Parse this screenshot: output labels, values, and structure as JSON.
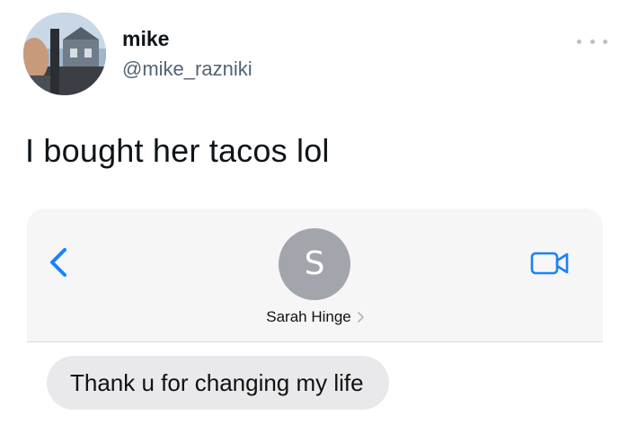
{
  "tweet": {
    "author_name": "mike",
    "author_handle": "@mike_razniki",
    "text": "I bought her tacos lol",
    "more_icon": "more-dots-icon"
  },
  "imessage": {
    "contact_initial": "S",
    "contact_name": "Sarah Hinge",
    "back_icon": "chevron-left-icon",
    "video_icon": "video-camera-icon",
    "contact_chevron_icon": "chevron-right-icon",
    "messages": [
      {
        "text": "Thank u for changing my life",
        "direction": "incoming"
      }
    ],
    "accent_color": "#1a82fb",
    "bubble_color": "#e9e9eb",
    "avatar_color": "#a2a5ab"
  }
}
